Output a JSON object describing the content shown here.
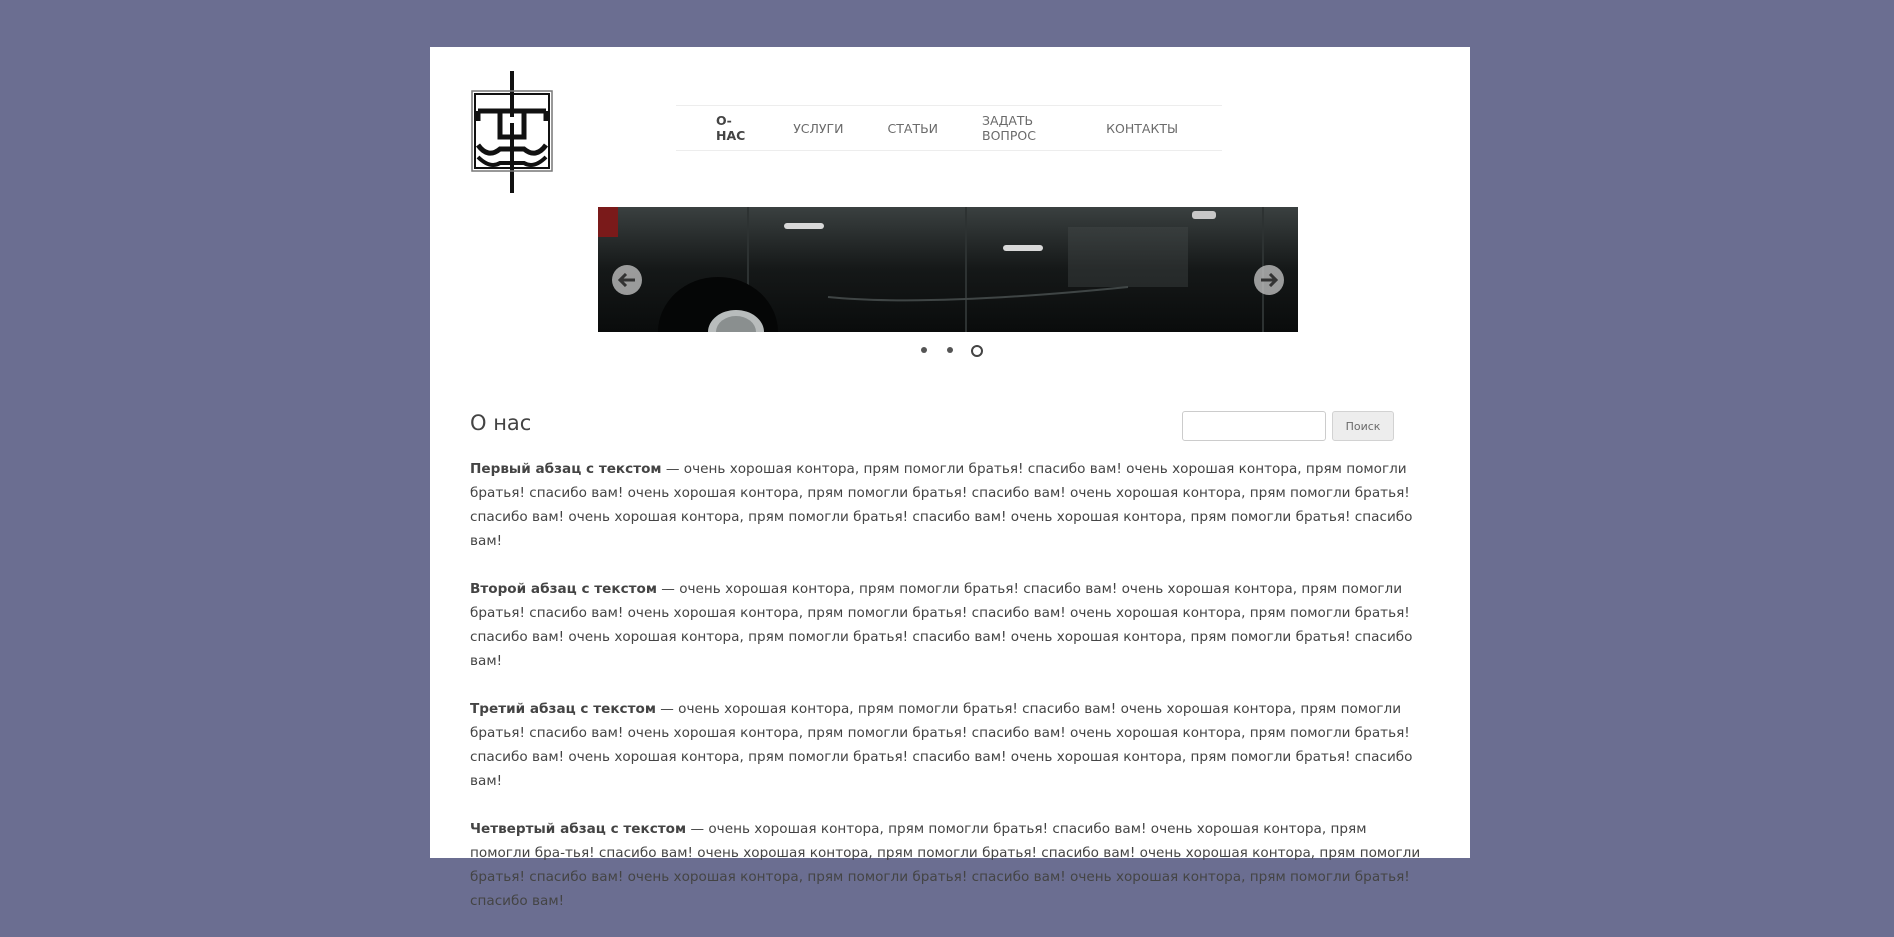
{
  "nav": {
    "items": [
      {
        "label": "О-НАС",
        "active": true
      },
      {
        "label": "УСЛУГИ",
        "active": false
      },
      {
        "label": "СТАТЬИ",
        "active": false
      },
      {
        "label": "ЗАДАТЬ ВОПРОС",
        "active": false
      },
      {
        "label": "КОНТАКТЫ",
        "active": false
      }
    ]
  },
  "slider": {
    "icons": {
      "prev": "arrow-left-icon",
      "next": "arrow-right-icon"
    },
    "slide_count": 3,
    "active_slide": 3
  },
  "page": {
    "title": "О нас"
  },
  "search": {
    "input_value": "",
    "button_label": "Поиск"
  },
  "paragraphs": [
    {
      "lead": "Первый абзац с текстом",
      "text": " — очень хорошая контора, прям помогли братья! спасибо вам! очень хорошая контора, прям помогли братья! спасибо вам! очень хорошая контора, прям помогли братья! спасибо вам! очень хорошая контора, прям помогли братья! спасибо вам! очень хорошая контора, прям помогли братья! спасибо вам! очень хорошая контора, прям помогли братья! спасибо вам!"
    },
    {
      "lead": "Второй абзац с текстом",
      "text": " — очень хорошая контора, прям помогли братья! спасибо вам! очень хорошая контора, прям помогли братья! спасибо вам! очень хорошая контора, прям помогли братья! спасибо вам! очень хорошая контора, прям помогли братья! спасибо вам! очень хорошая контора, прям помогли братья! спасибо вам! очень хорошая контора, прям помогли братья! спасибо вам!"
    },
    {
      "lead": "Третий абзац с текстом",
      "text": " — очень хорошая контора, прям помогли братья! спасибо вам! очень хорошая контора, прям помогли братья! спасибо вам! очень хорошая контора, прям помогли братья! спасибо вам! очень хорошая контора, прям помогли братья! спасибо вам! очень хорошая контора, прям помогли братья! спасибо вам! очень хорошая контора, прям помогли братья! спасибо вам!"
    },
    {
      "lead": "Четвертый абзац с текстом",
      "text": " — очень хорошая контора, прям помогли братья! спасибо вам! очень хорошая контора, прям помогли бра-тья! спасибо вам! очень хорошая контора, прям помогли братья! спасибо вам! очень хорошая контора, прям помогли братья! спасибо вам! очень хорошая контора, прям помогли братья! спасибо вам! очень хорошая контора, прям помогли братья! спасибо вам!"
    }
  ],
  "colors": {
    "background": "#6b6e91",
    "page": "#ffffff",
    "text": "#444444"
  }
}
